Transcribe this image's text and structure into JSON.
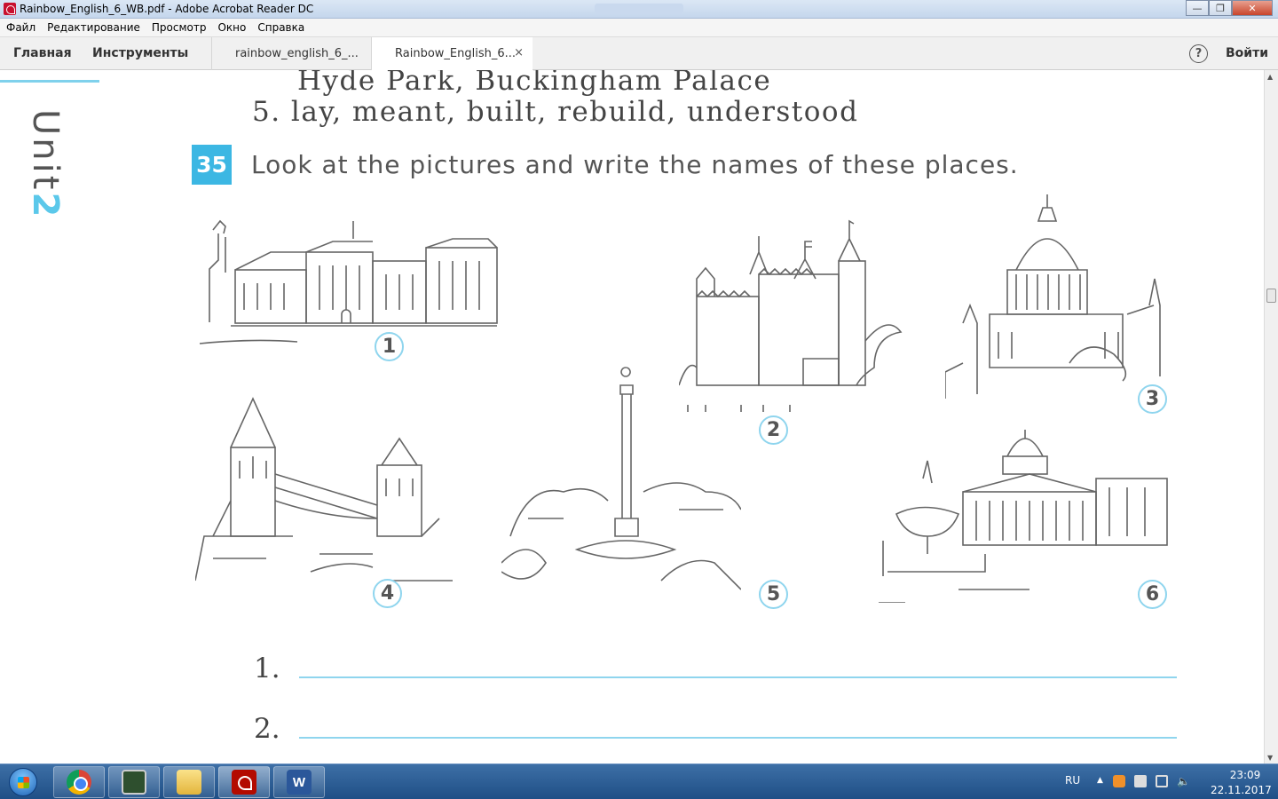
{
  "window": {
    "title": "Rainbow_English_6_WB.pdf - Adobe Acrobat Reader DC",
    "minimize": "—",
    "maximize": "❐",
    "close": "✕"
  },
  "menu": [
    "Файл",
    "Редактирование",
    "Просмотр",
    "Окно",
    "Справка"
  ],
  "toolbar": {
    "home": "Главная",
    "tools": "Инструменты",
    "doc_tabs": [
      "rainbow_english_6_...",
      "Rainbow_English_6..."
    ],
    "close_tab": "×",
    "help": "?",
    "login": "Войти"
  },
  "page": {
    "unit_word": "Unit",
    "unit_number": "2",
    "top_line": "Hyde Park, Buckingham Palace",
    "item5": "5. lay, meant, built, rebuild, understood",
    "exercise_number": "35",
    "exercise_text": "Look at the pictures and write the names of these places.",
    "picture_numbers": [
      "1",
      "2",
      "3",
      "4",
      "5",
      "6"
    ],
    "answer_numbers": [
      "1.",
      "2."
    ]
  },
  "taskbar": {
    "language": "RU",
    "tray_arrow": "▲",
    "time": "23:09",
    "date": "22.11.2017"
  },
  "colors": {
    "accent_cyan": "#3cb7e3",
    "line_cyan": "#8fd5ee",
    "taskbar": "#1f4f86"
  }
}
